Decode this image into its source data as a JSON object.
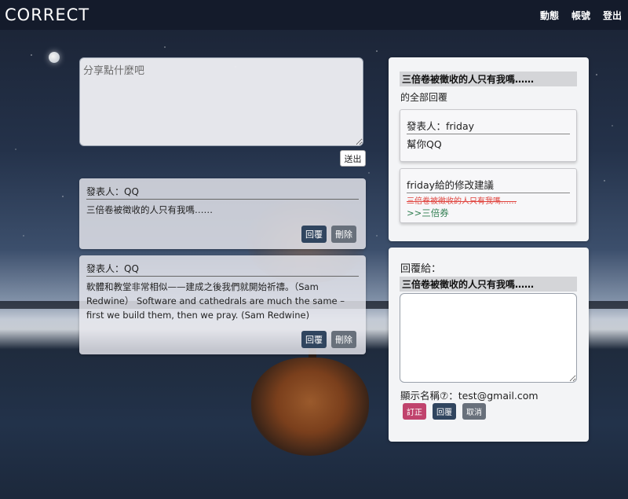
{
  "header": {
    "brand": "CORRECT",
    "nav": [
      "動態",
      "帳號",
      "登出"
    ]
  },
  "composer": {
    "placeholder": "分享點什麼吧",
    "send_label": "送出"
  },
  "posts": [
    {
      "author": "發表人：QQ",
      "body": "三倍卷被徵收的人只有我嗎……",
      "reply_label": "回覆",
      "delete_label": "刪除"
    },
    {
      "author": "發表人：QQ",
      "body": "軟體和教堂非常相似——建成之後我們就開始祈禱。（Sam Redwine） Software and cathedrals are much the same – first we build them, then we pray. (Sam Redwine)",
      "reply_label": "回覆",
      "delete_label": "刪除"
    }
  ],
  "thread_panel": {
    "title": "三倍卷被徵收的人只有我嗎……",
    "subtitle": "的全部回覆",
    "reply": {
      "author": "發表人：friday",
      "text": "幫你QQ"
    },
    "suggestion": {
      "heading": "friday給的修改建議",
      "original": "三倍卷被徵收的人只有我嗎……",
      "corrected": ">>三倍券"
    }
  },
  "reply_panel": {
    "label": "回覆給：",
    "target": "三倍卷被徵收的人只有我嗎……",
    "display_name": "顯示名稱⑦：test@gmail.com",
    "correct_label": "訂正",
    "reply_label": "回覆",
    "cancel_label": "取消"
  },
  "colors": {
    "navbar": "#141b2b",
    "reply_button": "#30455f",
    "delete_button": "#68707b",
    "correct_button": "#c0436d",
    "strike_text": "#e0443e",
    "correction_text": "#2f7d50"
  }
}
